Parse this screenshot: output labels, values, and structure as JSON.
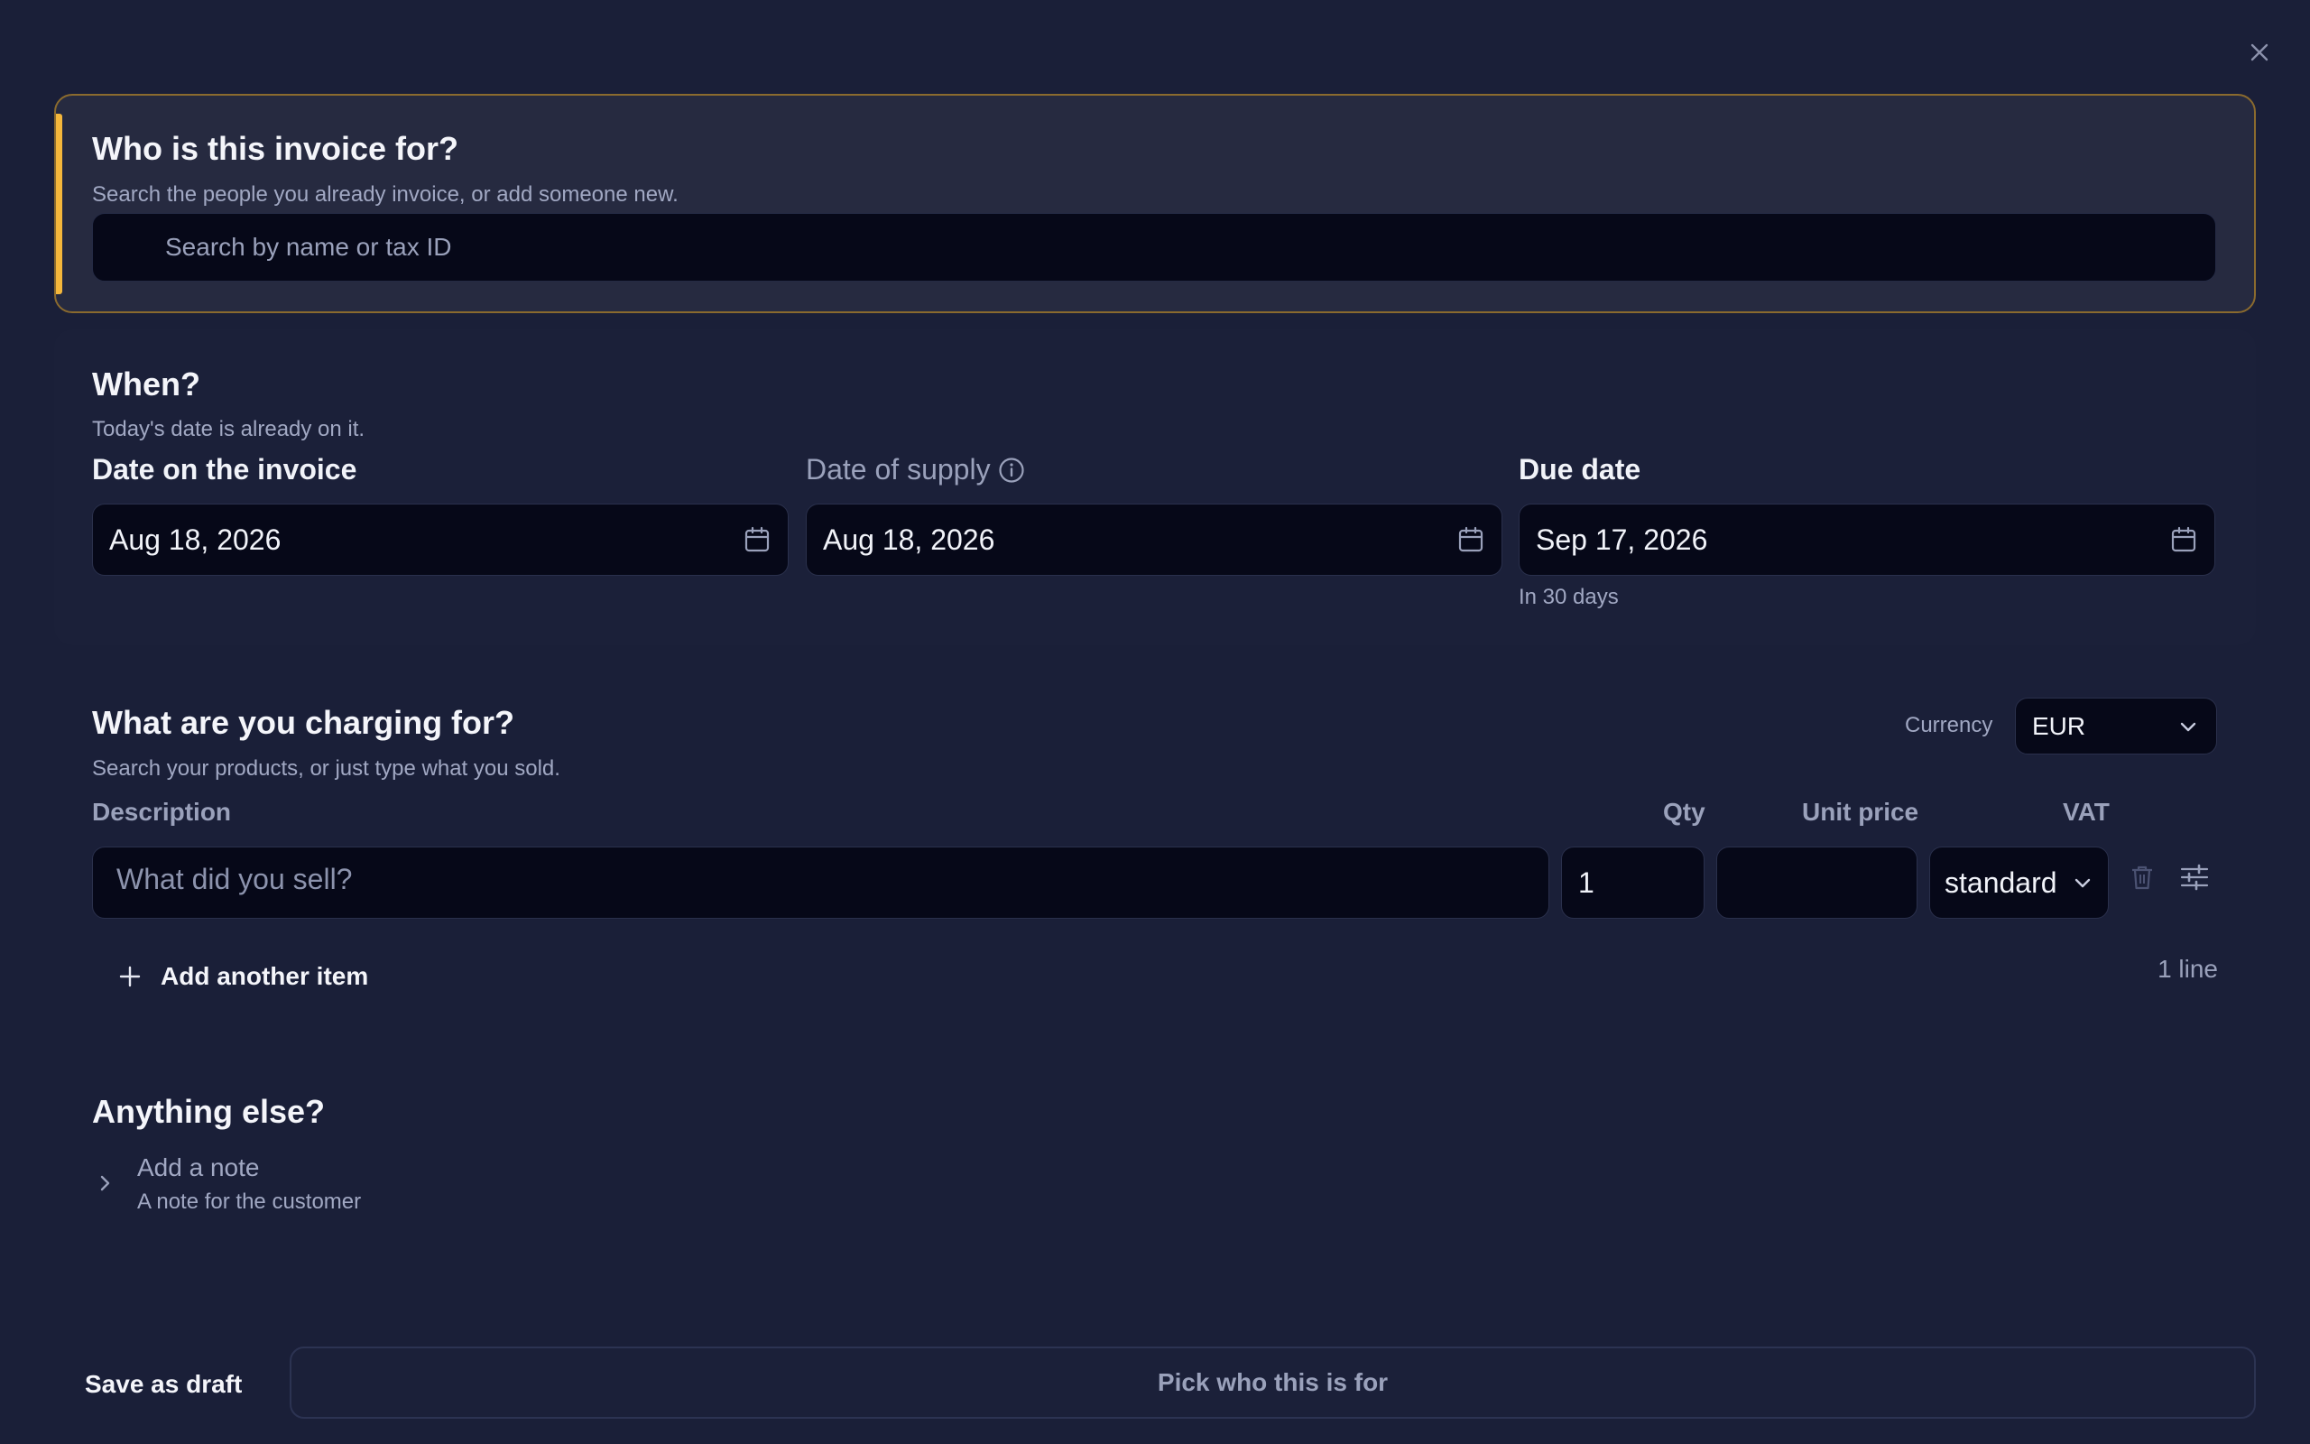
{
  "customer": {
    "title": "Who is this invoice for?",
    "subtitle": "Search the people you already invoice, or add someone new.",
    "search_placeholder": "Search by name or tax ID"
  },
  "when": {
    "title": "When?",
    "subtitle": "Today's date is already on it.",
    "invoice_date": {
      "label": "Date on the invoice",
      "value": "Aug 18, 2026"
    },
    "supply_date": {
      "label": "Date of supply",
      "value": "Aug 18, 2026"
    },
    "due_date": {
      "label": "Due date",
      "value": "Sep 17, 2026",
      "hint": "In 30 days"
    }
  },
  "items": {
    "title": "What are you charging for?",
    "subtitle": "Search your products, or just type what you sold.",
    "currency_label": "Currency",
    "currency_value": "EUR",
    "columns": {
      "description": "Description",
      "qty": "Qty",
      "unit_price": "Unit price",
      "vat": "VAT"
    },
    "rows": [
      {
        "description_placeholder": "What did you sell?",
        "qty": "1",
        "unit_price": "",
        "vat": "standard"
      }
    ],
    "add_label": "Add another item",
    "line_count": "1 line"
  },
  "extra": {
    "title": "Anything else?",
    "note_title": "Add a note",
    "note_subtitle": "A note for the customer"
  },
  "footer": {
    "save_draft": "Save as draft",
    "primary": "Pick who this is for"
  }
}
